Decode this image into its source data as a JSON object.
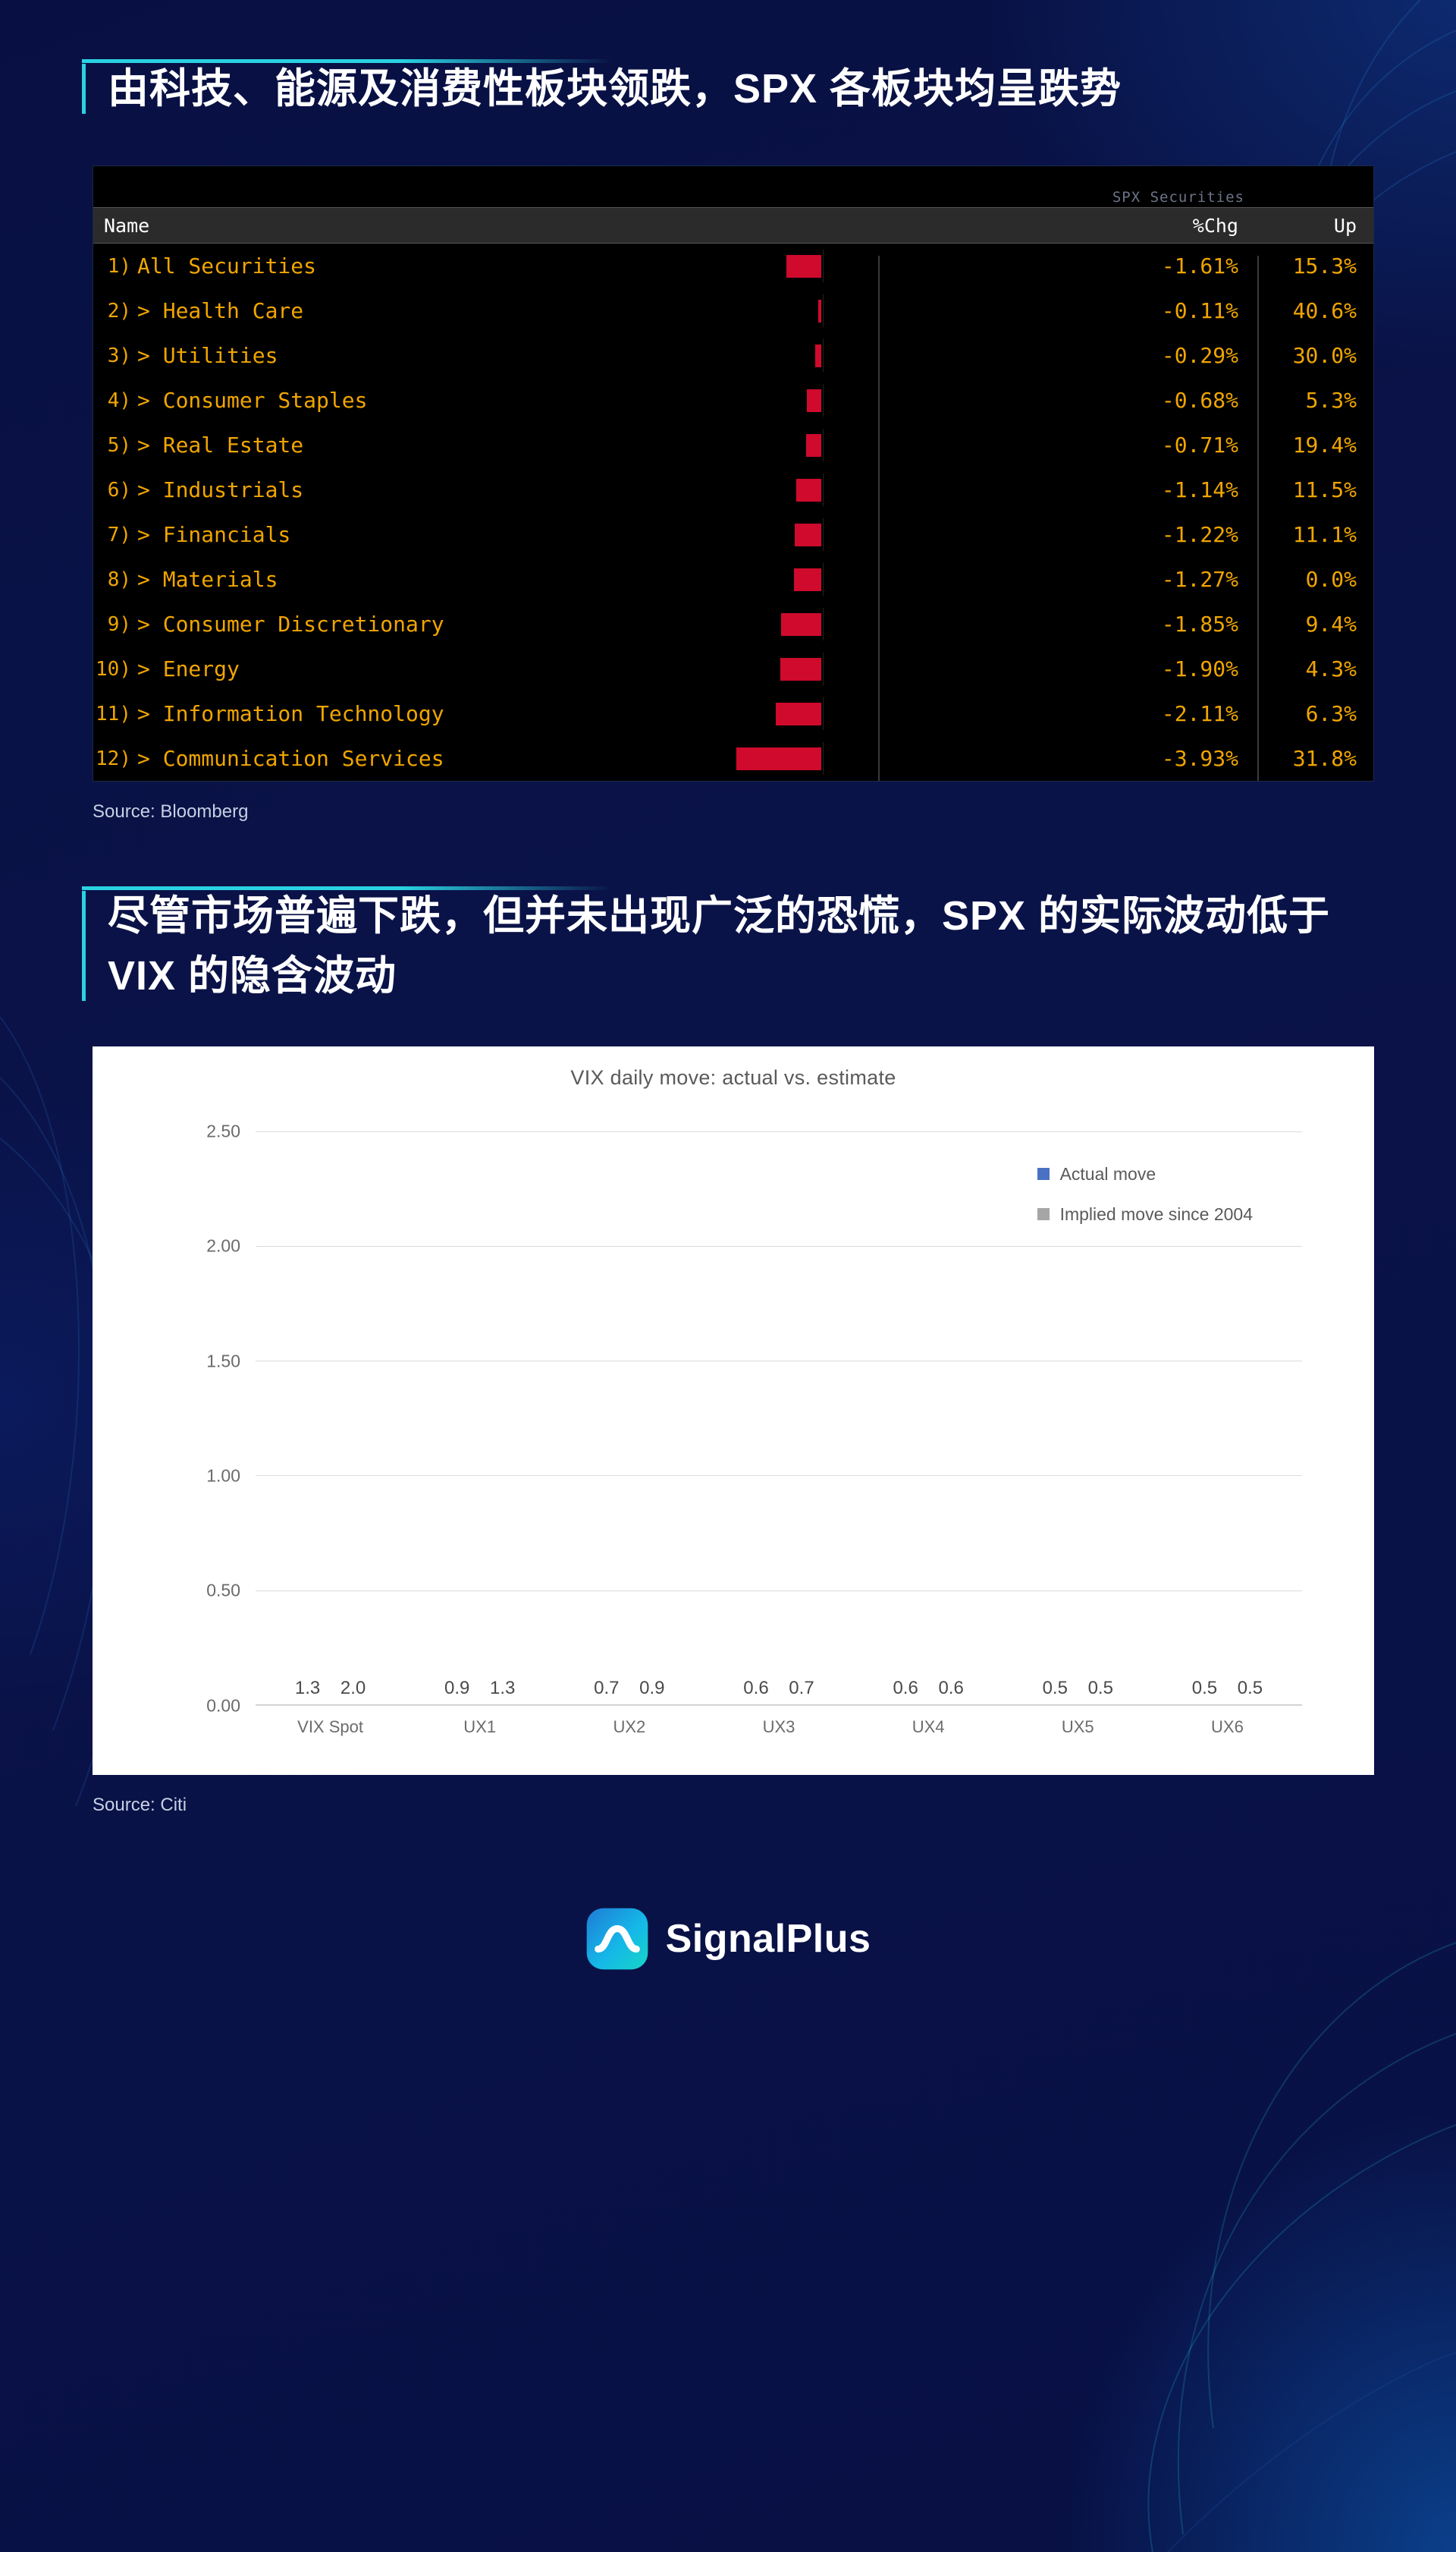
{
  "colors": {
    "accent": "#2ad2e2",
    "bg": "#0a1046",
    "bloomberg_text": "#f0a500",
    "bar_red": "#cf0a2c",
    "actual_blue": "#4a72c4",
    "implied_gray": "#a6a6a6"
  },
  "section1": {
    "heading": "由科技、能源及消费性板块领跌，SPX 各板块均呈跌势",
    "source": "Source: Bloomberg",
    "table": {
      "columns": [
        "Name",
        "%Chg",
        "Up"
      ],
      "ghost_header": "SPX Securities",
      "rows": [
        {
          "n": "1)",
          "name": "All Securities",
          "child": false,
          "chg": "-1.61%",
          "up": "15.3%",
          "bar": 46
        },
        {
          "n": "2)",
          "name": "Health Care",
          "child": true,
          "chg": "-0.11%",
          "up": "40.6%",
          "bar": 4
        },
        {
          "n": "3)",
          "name": "Utilities",
          "child": true,
          "chg": "-0.29%",
          "up": "30.0%",
          "bar": 8
        },
        {
          "n": "4)",
          "name": "Consumer Staples",
          "child": true,
          "chg": "-0.68%",
          "up": "5.3%",
          "bar": 19
        },
        {
          "n": "5)",
          "name": "Real Estate",
          "child": true,
          "chg": "-0.71%",
          "up": "19.4%",
          "bar": 20
        },
        {
          "n": "6)",
          "name": "Industrials",
          "child": true,
          "chg": "-1.14%",
          "up": "11.5%",
          "bar": 33
        },
        {
          "n": "7)",
          "name": "Financials",
          "child": true,
          "chg": "-1.22%",
          "up": "11.1%",
          "bar": 35
        },
        {
          "n": "8)",
          "name": "Materials",
          "child": true,
          "chg": "-1.27%",
          "up": "0.0%",
          "bar": 36
        },
        {
          "n": "9)",
          "name": "Consumer Discretionary",
          "child": true,
          "chg": "-1.85%",
          "up": "9.4%",
          "bar": 53
        },
        {
          "n": "10)",
          "name": "Energy",
          "child": true,
          "chg": "-1.90%",
          "up": "4.3%",
          "bar": 54
        },
        {
          "n": "11)",
          "name": "Information Technology",
          "child": true,
          "chg": "-2.11%",
          "up": "6.3%",
          "bar": 60
        },
        {
          "n": "12)",
          "name": "Communication Services",
          "child": true,
          "chg": "-3.93%",
          "up": "31.8%",
          "bar": 112
        }
      ]
    }
  },
  "section2": {
    "heading": "尽管市场普遍下跌，但并未出现广泛的恐慌，SPX 的实际波动低于 VIX 的隐含波动",
    "source": "Source: Citi"
  },
  "chart_data": {
    "type": "bar",
    "title": "VIX daily move: actual vs. estimate",
    "categories": [
      "VIX Spot",
      "UX1",
      "UX2",
      "UX3",
      "UX4",
      "UX5",
      "UX6"
    ],
    "series": [
      {
        "name": "Actual move",
        "color": "#4a72c4",
        "values": [
          1.3,
          0.9,
          0.7,
          0.6,
          0.6,
          0.5,
          0.5
        ],
        "raw": [
          1.26,
          0.91,
          0.7,
          0.65,
          0.57,
          0.48,
          0.46
        ]
      },
      {
        "name": "Implied move since 2004",
        "color": "#a6a6a6",
        "values": [
          2.0,
          1.3,
          0.9,
          0.7,
          0.6,
          0.5,
          0.5
        ],
        "raw": [
          2.04,
          1.31,
          0.92,
          0.72,
          0.61,
          0.53,
          0.48
        ]
      }
    ],
    "ylim": [
      0,
      2.5
    ],
    "yticks": [
      "0.00",
      "0.50",
      "1.00",
      "1.50",
      "2.00",
      "2.50"
    ],
    "ytick_values": [
      0,
      0.5,
      1.0,
      1.5,
      2.0,
      2.5
    ],
    "xlabel": "",
    "ylabel": "",
    "grid": true,
    "legend_position": "top-right"
  },
  "footer": {
    "brand": "SignalPlus"
  }
}
